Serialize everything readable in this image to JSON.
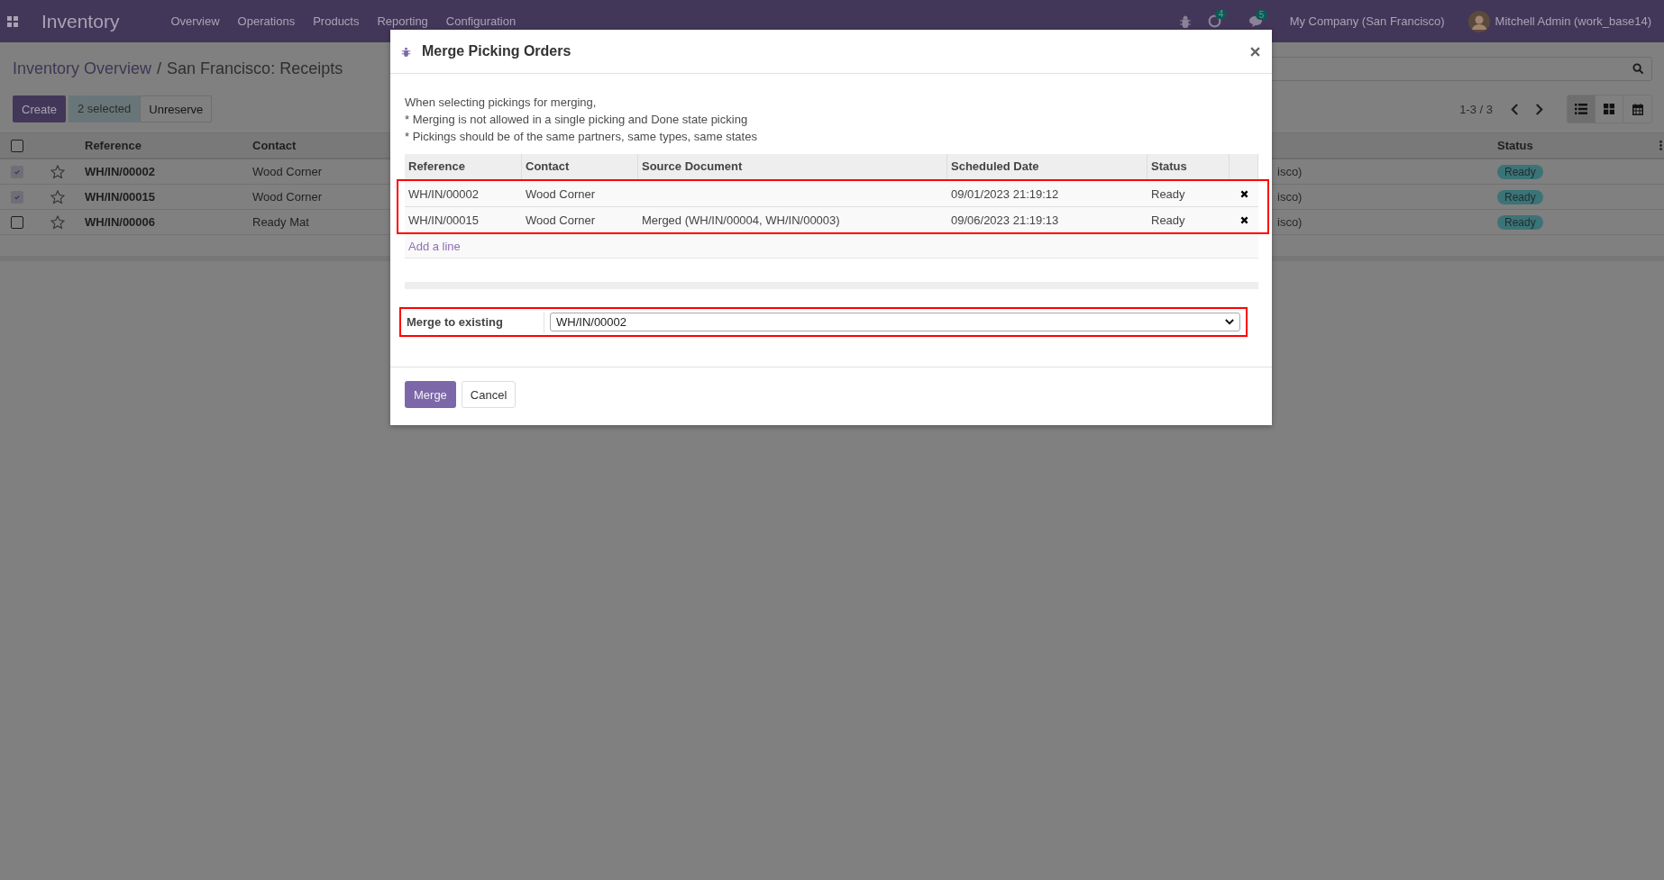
{
  "topbar": {
    "app": "Inventory",
    "menu": [
      "Overview",
      "Operations",
      "Products",
      "Reporting",
      "Configuration"
    ],
    "activity_count": "4",
    "message_count": "5",
    "company": "My Company (San Francisco)",
    "user": "Mitchell Admin (work_base14)"
  },
  "breadcrumb": [
    {
      "label": "Inventory Overview",
      "kind": "link"
    },
    {
      "label": "/",
      "kind": "separator"
    },
    {
      "label": "San Francisco: Receipts",
      "kind": "current"
    }
  ],
  "toolbar": {
    "create": "Create",
    "selected_count": "2 selected",
    "unreserve": "Unreserve",
    "pager": "1-3 / 3"
  },
  "views": [
    {
      "kind": "list",
      "selected": true
    },
    {
      "kind": "kanban",
      "selected": false
    },
    {
      "kind": "calendar",
      "selected": false
    }
  ],
  "list": {
    "select_all": false,
    "columns": [
      "Reference",
      "Contact",
      "Status"
    ],
    "rows": [
      {
        "checked": true,
        "reference": "WH/IN/00002",
        "contact": "Wood Corner",
        "column_3": "isco)",
        "status": "Ready"
      },
      {
        "checked": true,
        "reference": "WH/IN/00015",
        "contact": "Wood Corner",
        "column_3": "isco)",
        "status": "Ready"
      },
      {
        "checked": false,
        "reference": "WH/IN/00006",
        "contact": "Ready Mat",
        "column_3": "isco)",
        "status": "Ready"
      }
    ]
  },
  "dialog": {
    "title": "Merge Picking Orders",
    "notes": [
      "When selecting pickings for merging,",
      "* Merging is not allowed in a single picking and Done state picking",
      "* Pickings should be of the same partners, same types, same states"
    ],
    "columns": [
      "Reference",
      "Contact",
      "Source Document",
      "Scheduled Date",
      "Status"
    ],
    "rows": [
      {
        "reference": "WH/IN/00002",
        "contact": "Wood Corner",
        "date": "09/01/2023 21:19:12",
        "status": "Ready"
      },
      {
        "reference": "WH/IN/00015",
        "contact": "Wood Corner",
        "source": "Merged (WH/IN/00004, WH/IN/00003)",
        "date": "09/06/2023 21:19:13",
        "status": "Ready"
      }
    ],
    "add_line": "Add a line",
    "merge_label": "Merge to existing",
    "merge_value": "WH/IN/00002",
    "merge_button": "Merge",
    "cancel_button": "Cancel"
  }
}
